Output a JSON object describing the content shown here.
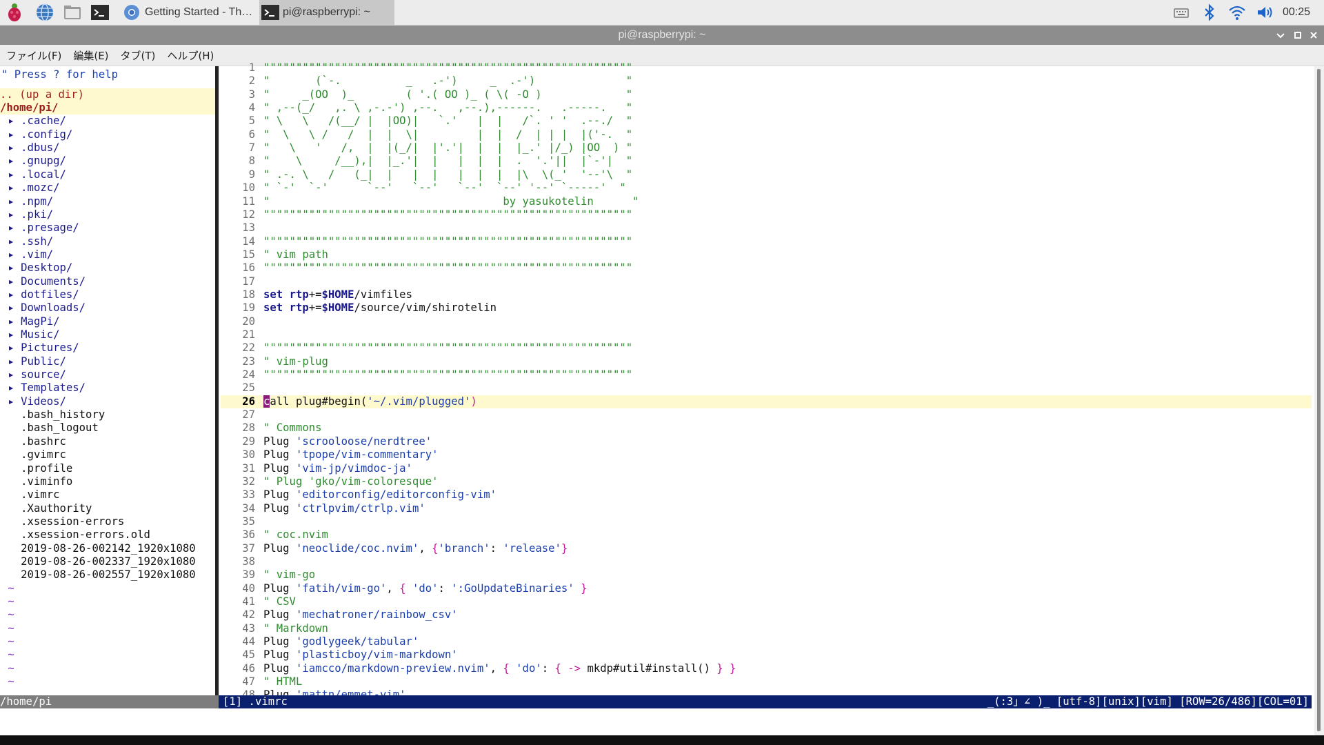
{
  "taskbar": {
    "tasks": [
      {
        "label": "Getting Started - The ...",
        "icon": "chromium-icon"
      },
      {
        "label": "pi@raspberrypi: ~",
        "icon": "terminal-icon"
      }
    ],
    "clock": "00:25"
  },
  "window": {
    "title": "pi@raspberrypi: ~",
    "menu": [
      "ファイル(F)",
      "編集(E)",
      "タブ(T)",
      "ヘルプ(H)"
    ]
  },
  "nerdtree": {
    "help": "\" Press ? for help",
    "updir": ".. (up a dir)",
    "root": "/home/pi/",
    "dirs": [
      ".cache/",
      ".config/",
      ".dbus/",
      ".gnupg/",
      ".local/",
      ".mozc/",
      ".npm/",
      ".pki/",
      ".presage/",
      ".ssh/",
      ".vim/",
      "Desktop/",
      "Documents/",
      "dotfiles/",
      "Downloads/",
      "MagPi/",
      "Music/",
      "Pictures/",
      "Public/",
      "source/",
      "Templates/",
      "Videos/"
    ],
    "files": [
      ".bash_history",
      ".bash_logout",
      ".bashrc",
      ".gvimrc",
      ".profile",
      ".viminfo",
      ".vimrc",
      ".Xauthority",
      ".xsession-errors",
      ".xsession-errors.old",
      "2019-08-26-002142_1920x1080",
      "2019-08-26-002337_1920x1080",
      "2019-08-26-002557_1920x1080"
    ],
    "tilde_count": 8,
    "status": "/home/pi"
  },
  "editor": {
    "cursor_line": 26,
    "lines": [
      [
        [
          "c-comment",
          "\"\"\"\"\"\"\"\"\"\"\"\"\"\"\"\"\"\"\"\"\"\"\"\"\"\"\"\"\"\"\"\"\"\"\"\"\"\"\"\"\"\"\"\"\"\"\"\"\"\"\"\"\"\"\"\"\""
        ]
      ],
      [
        [
          "c-comment",
          "\"       (`-.          _   .-')     _  .-')              \""
        ]
      ],
      [
        [
          "c-comment",
          "\"     _(OO  )_        ( '.( OO )_ ( \\( -O )             \""
        ]
      ],
      [
        [
          "c-comment",
          "\" ,--(_/   ,. \\ ,-.-') ,--.   ,--.),------.   .-----.   \""
        ]
      ],
      [
        [
          "c-comment",
          "\" \\   \\   /(__/ |  |OO)|   `.'   |  |   /`. ' '  .--./  \""
        ]
      ],
      [
        [
          "c-comment",
          "\"  \\   \\ /   /  |  |  \\|         |  |  /  | | |  |('-.  \""
        ]
      ],
      [
        [
          "c-comment",
          "\"   \\   '   /,  |  |(_/|  |'.'|  |  |  |_.' |/_) |OO  ) \""
        ]
      ],
      [
        [
          "c-comment",
          "\"    \\     /__),|  |_.'|  |   |  |  |  .  '.'||  |`-'|  \""
        ]
      ],
      [
        [
          "c-comment",
          "\" .-. \\   /   (_|  |   |  |   |  |  |  |\\  \\(_'  '--'\\  \""
        ]
      ],
      [
        [
          "c-comment",
          "\" `-'  `-'      `--'   `--'   `--'  `--' '--' `-----'  \""
        ]
      ],
      [
        [
          "c-comment",
          "\"                                    by yasukotelin      \""
        ]
      ],
      [
        [
          "c-comment",
          "\"\"\"\"\"\"\"\"\"\"\"\"\"\"\"\"\"\"\"\"\"\"\"\"\"\"\"\"\"\"\"\"\"\"\"\"\"\"\"\"\"\"\"\"\"\"\"\"\"\"\"\"\"\"\"\"\""
        ]
      ],
      [],
      [
        [
          "c-comment",
          "\"\"\"\"\"\"\"\"\"\"\"\"\"\"\"\"\"\"\"\"\"\"\"\"\"\"\"\"\"\"\"\"\"\"\"\"\"\"\"\"\"\"\"\"\"\"\"\"\"\"\"\"\"\"\"\"\""
        ]
      ],
      [
        [
          "c-comment",
          "\" vim path"
        ]
      ],
      [
        [
          "c-comment",
          "\"\"\"\"\"\"\"\"\"\"\"\"\"\"\"\"\"\"\"\"\"\"\"\"\"\"\"\"\"\"\"\"\"\"\"\"\"\"\"\"\"\"\"\"\"\"\"\"\"\"\"\"\"\"\"\"\""
        ]
      ],
      [],
      [
        [
          "c-kw",
          "set"
        ],
        [
          "c-plain",
          " "
        ],
        [
          "c-kw",
          "rtp"
        ],
        [
          "c-plain",
          "+="
        ],
        [
          "c-var",
          "$HOME"
        ],
        [
          "c-plain",
          "/vimfiles"
        ]
      ],
      [
        [
          "c-kw",
          "set"
        ],
        [
          "c-plain",
          " "
        ],
        [
          "c-kw",
          "rtp"
        ],
        [
          "c-plain",
          "+="
        ],
        [
          "c-var",
          "$HOME"
        ],
        [
          "c-plain",
          "/source/vim/shirotelin"
        ]
      ],
      [],
      [],
      [
        [
          "c-comment",
          "\"\"\"\"\"\"\"\"\"\"\"\"\"\"\"\"\"\"\"\"\"\"\"\"\"\"\"\"\"\"\"\"\"\"\"\"\"\"\"\"\"\"\"\"\"\"\"\"\"\"\"\"\"\"\"\"\""
        ]
      ],
      [
        [
          "c-comment",
          "\" vim-plug"
        ]
      ],
      [
        [
          "c-comment",
          "\"\"\"\"\"\"\"\"\"\"\"\"\"\"\"\"\"\"\"\"\"\"\"\"\"\"\"\"\"\"\"\"\"\"\"\"\"\"\"\"\"\"\"\"\"\"\"\"\"\"\"\"\"\"\"\"\""
        ]
      ],
      [],
      [
        [
          "cursor",
          "c"
        ],
        [
          "c-plain",
          "all plug#begin("
        ],
        [
          "c-str",
          "'~/.vim/plugged'"
        ],
        [
          "c-brace",
          ")"
        ]
      ],
      [],
      [
        [
          "c-comment",
          "\" Commons"
        ]
      ],
      [
        [
          "c-plain",
          "Plug "
        ],
        [
          "c-str",
          "'scrooloose/nerdtree'"
        ]
      ],
      [
        [
          "c-plain",
          "Plug "
        ],
        [
          "c-str",
          "'tpope/vim-commentary'"
        ]
      ],
      [
        [
          "c-plain",
          "Plug "
        ],
        [
          "c-str",
          "'vim-jp/vimdoc-ja'"
        ]
      ],
      [
        [
          "c-comment",
          "\" Plug 'gko/vim-coloresque'"
        ]
      ],
      [
        [
          "c-plain",
          "Plug "
        ],
        [
          "c-str",
          "'editorconfig/editorconfig-vim'"
        ]
      ],
      [
        [
          "c-plain",
          "Plug "
        ],
        [
          "c-str",
          "'ctrlpvim/ctrlp.vim'"
        ]
      ],
      [],
      [
        [
          "c-comment",
          "\" coc.nvim"
        ]
      ],
      [
        [
          "c-plain",
          "Plug "
        ],
        [
          "c-str",
          "'neoclide/coc.nvim'"
        ],
        [
          "c-plain",
          ", "
        ],
        [
          "c-brace",
          "{"
        ],
        [
          "c-str",
          "'branch'"
        ],
        [
          "c-plain",
          ": "
        ],
        [
          "c-str",
          "'release'"
        ],
        [
          "c-brace",
          "}"
        ]
      ],
      [],
      [
        [
          "c-comment",
          "\" vim-go"
        ]
      ],
      [
        [
          "c-plain",
          "Plug "
        ],
        [
          "c-str",
          "'fatih/vim-go'"
        ],
        [
          "c-plain",
          ", "
        ],
        [
          "c-brace",
          "{"
        ],
        [
          "c-plain",
          " "
        ],
        [
          "c-str",
          "'do'"
        ],
        [
          "c-plain",
          ": "
        ],
        [
          "c-str",
          "':GoUpdateBinaries'"
        ],
        [
          "c-plain",
          " "
        ],
        [
          "c-brace",
          "}"
        ]
      ],
      [
        [
          "c-comment",
          "\" CSV"
        ]
      ],
      [
        [
          "c-plain",
          "Plug "
        ],
        [
          "c-str",
          "'mechatroner/rainbow_csv'"
        ]
      ],
      [
        [
          "c-comment",
          "\" Markdown"
        ]
      ],
      [
        [
          "c-plain",
          "Plug "
        ],
        [
          "c-str",
          "'godlygeek/tabular'"
        ]
      ],
      [
        [
          "c-plain",
          "Plug "
        ],
        [
          "c-str",
          "'plasticboy/vim-markdown'"
        ]
      ],
      [
        [
          "c-plain",
          "Plug "
        ],
        [
          "c-str",
          "'iamcco/markdown-preview.nvim'"
        ],
        [
          "c-plain",
          ", "
        ],
        [
          "c-brace",
          "{"
        ],
        [
          "c-plain",
          " "
        ],
        [
          "c-str",
          "'do'"
        ],
        [
          "c-plain",
          ": "
        ],
        [
          "c-brace",
          "{"
        ],
        [
          "c-plain",
          " "
        ],
        [
          "c-brace",
          "->"
        ],
        [
          "c-plain",
          " mkdp#util#install() "
        ],
        [
          "c-brace",
          "}"
        ],
        [
          "c-plain",
          " "
        ],
        [
          "c-brace",
          "}"
        ]
      ],
      [
        [
          "c-comment",
          "\" HTML"
        ]
      ],
      [
        [
          "c-plain",
          "Plug "
        ],
        [
          "c-str",
          "'mattn/emmet-vim'"
        ]
      ]
    ],
    "status_left": "[1] .vimrc",
    "status_right": "_(:3」∠ )_ [utf-8][unix][vim] [ROW=26/486][COL=01]"
  }
}
